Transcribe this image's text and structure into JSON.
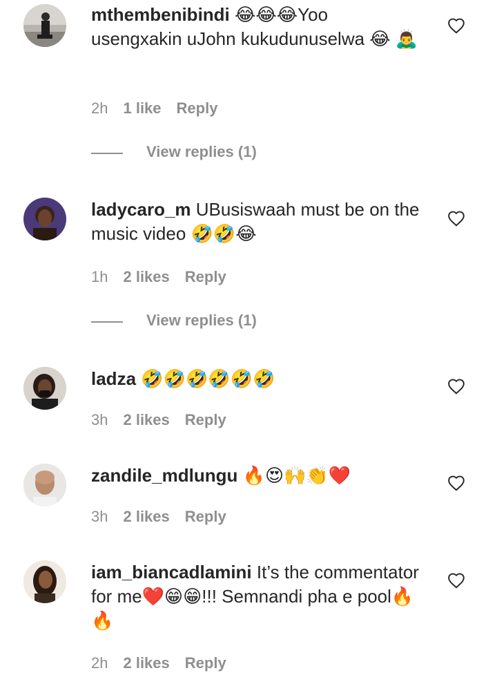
{
  "comments": [
    {
      "username": "mthembenibindi",
      "text": "😂😂😂Yoo usengxakin uJohn kukudunuselwa 😂 🙇‍♂️",
      "time": "2h",
      "likes": "1 like",
      "reply": "Reply",
      "view_replies": "View replies (1)"
    },
    {
      "username": "ladycaro_m",
      "text": "UBusiswaah must be on the music video 🤣🤣😂",
      "time": "1h",
      "likes": "2 likes",
      "reply": "Reply",
      "view_replies": "View replies (1)"
    },
    {
      "username": "ladza",
      "text": "🤣🤣🤣🤣🤣🤣",
      "time": "3h",
      "likes": "2 likes",
      "reply": "Reply"
    },
    {
      "username": "zandile_mdlungu",
      "text": "🔥😍🙌👏❤️",
      "time": "3h",
      "likes": "2 likes",
      "reply": "Reply"
    },
    {
      "username": "iam_biancadlamini",
      "text": "It’s the commentator for me❤️😁😁!!! Semnandi pha e pool🔥 🔥",
      "time": "2h",
      "likes": "2 likes",
      "reply": "Reply"
    }
  ],
  "colors": {
    "text": "#262626",
    "secondary": "#8e8e8e",
    "background": "#ffffff"
  },
  "icons": [
    "heart-icon"
  ]
}
